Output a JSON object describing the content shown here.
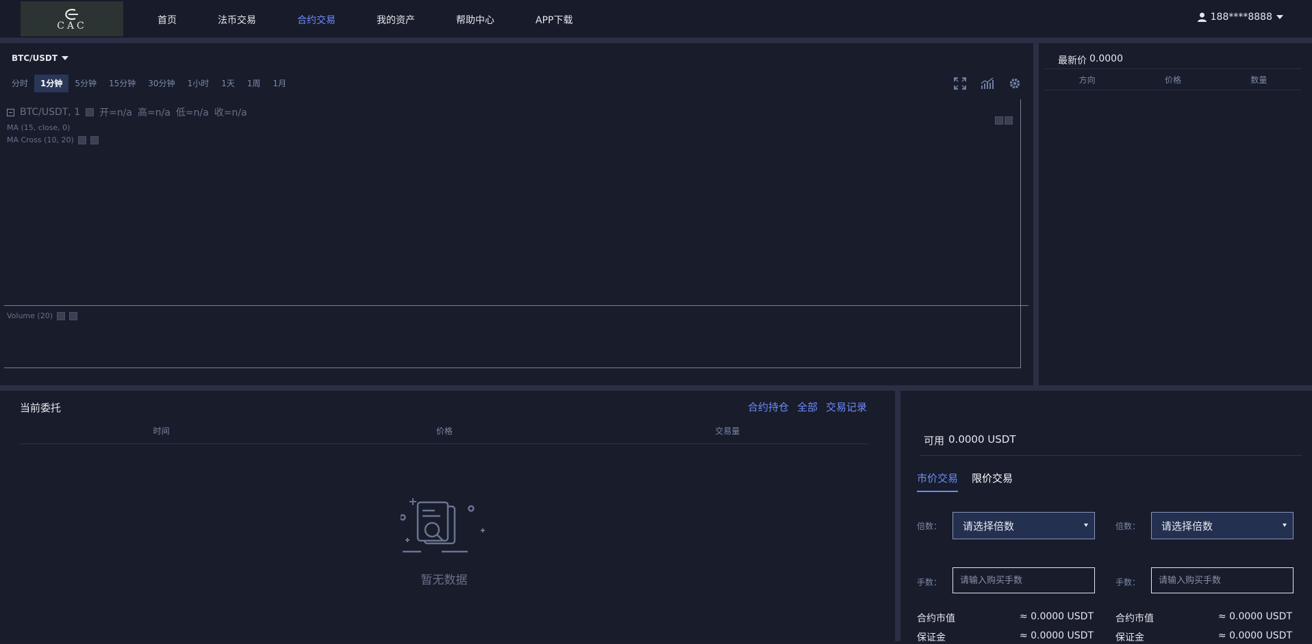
{
  "header": {
    "logo_text": "CAC",
    "nav": [
      {
        "label": "首页",
        "active": false
      },
      {
        "label": "法币交易",
        "active": false
      },
      {
        "label": "合约交易",
        "active": true
      },
      {
        "label": "我的资产",
        "active": false
      },
      {
        "label": "帮助中心",
        "active": false
      },
      {
        "label": "APP下载",
        "active": false
      }
    ],
    "user": "188****8888"
  },
  "chart": {
    "pair": "BTC/USDT",
    "intervals": [
      "分时",
      "1分钟",
      "5分钟",
      "15分钟",
      "30分钟",
      "1小时",
      "1天",
      "1周",
      "1月"
    ],
    "active_interval": "1分钟",
    "legend_symbol": "BTC/USDT, 1",
    "ohlc": {
      "open": "开=n/a",
      "high": "高=n/a",
      "low": "低=n/a",
      "close": "收=n/a"
    },
    "study_ma": "MA (15, close, 0)",
    "study_ma_cross": "MA Cross (10, 20)",
    "study_volume": "Volume (20)"
  },
  "depth": {
    "latest_label": "最新价",
    "latest_value": "0.0000",
    "columns": [
      "方向",
      "价格",
      "数量"
    ]
  },
  "orders": {
    "title": "当前委托",
    "links": [
      "合约持仓",
      "全部",
      "交易记录"
    ],
    "columns": [
      "时间",
      "价格",
      "交易量"
    ],
    "empty_text": "暂无数据"
  },
  "trade": {
    "available_label": "可用",
    "available_value": "0.0000 USDT",
    "tabs": [
      {
        "label": "市价交易",
        "active": true
      },
      {
        "label": "限价交易",
        "active": false
      }
    ],
    "left": {
      "multiplier_label": "倍数：",
      "multiplier_value": "请选择倍数",
      "lots_label": "手数：",
      "lots_placeholder": "请输入购买手数",
      "contract_value_label": "合约市值",
      "contract_value": "≈ 0.0000 USDT",
      "margin_label": "保证金",
      "margin_value": "≈ 0.0000 USDT"
    },
    "right": {
      "multiplier_label": "倍数：",
      "multiplier_value": "请选择倍数",
      "lots_label": "手数：",
      "lots_placeholder": "请输入购买手数",
      "contract_value_label": "合约市值",
      "contract_value": "≈ 0.0000 USDT",
      "margin_label": "保证金",
      "margin_value": "≈ 0.0000 USDT"
    }
  },
  "colors": {
    "accent": "#6f8dff",
    "background": "#1a1e2d",
    "panel": "#181c2b"
  }
}
